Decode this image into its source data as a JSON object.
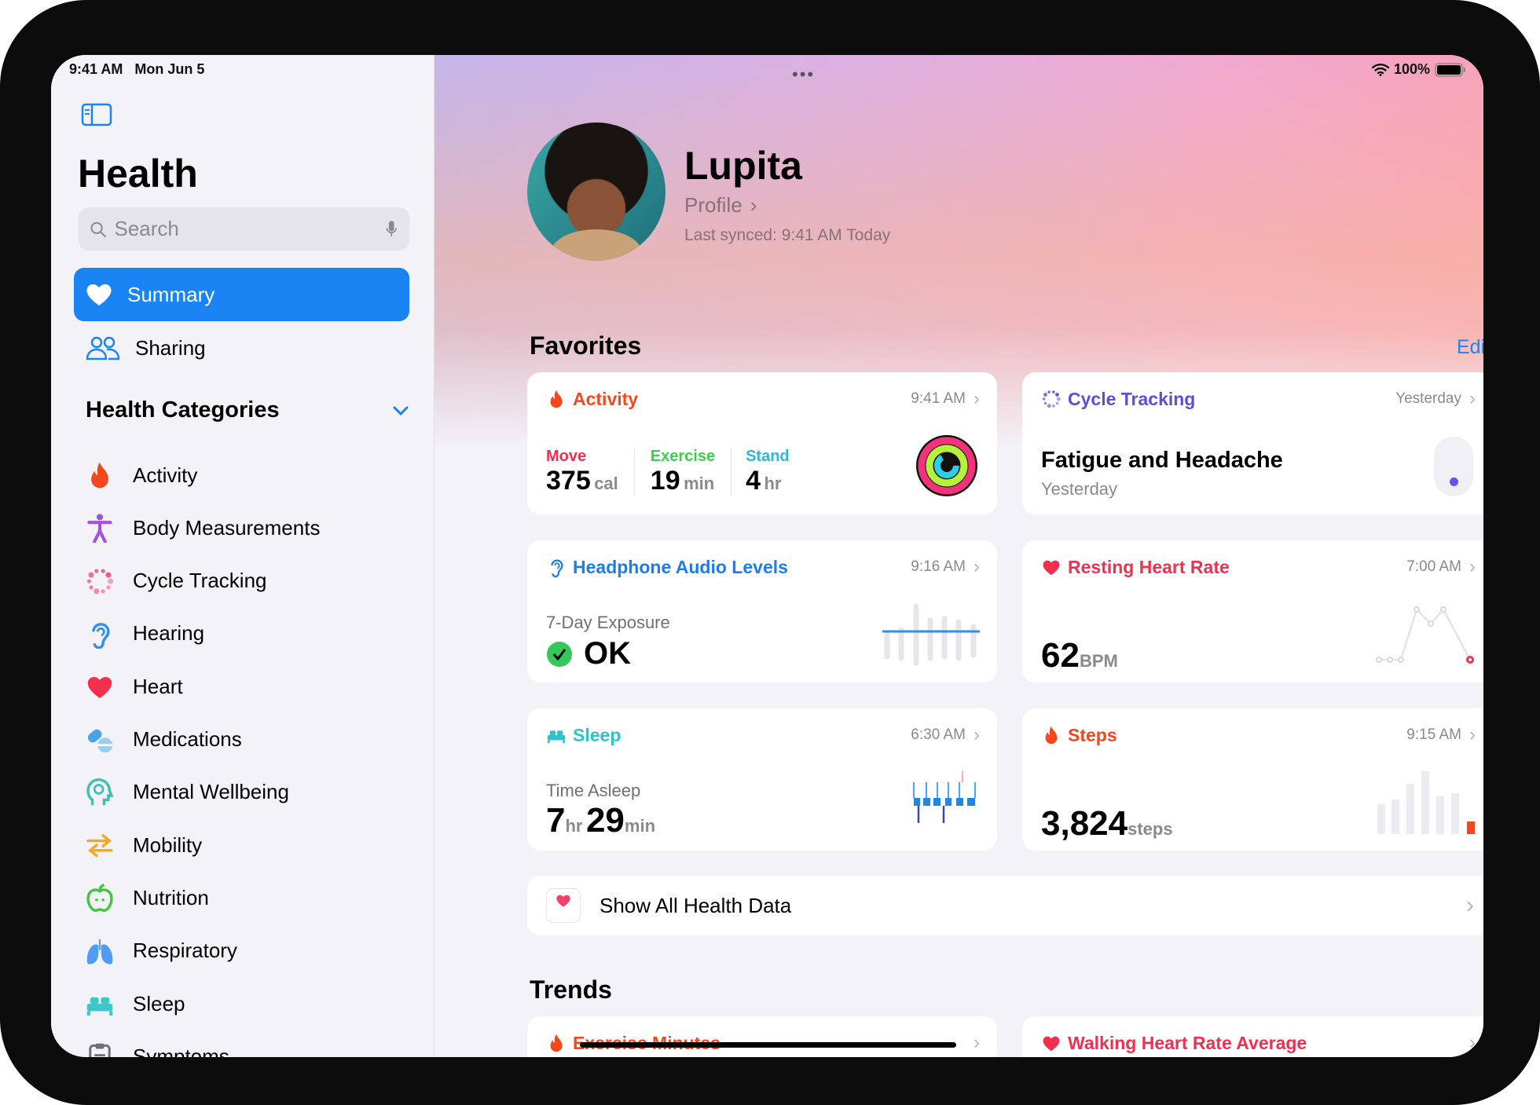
{
  "status": {
    "time": "9:41 AM",
    "date": "Mon Jun 5",
    "battery": "100%"
  },
  "sidebar": {
    "title": "Health",
    "search_placeholder": "Search",
    "nav": [
      {
        "label": "Summary",
        "icon": "heart-icon"
      },
      {
        "label": "Sharing",
        "icon": "people-icon"
      }
    ],
    "categories_title": "Health Categories",
    "categories": [
      {
        "label": "Activity",
        "icon": "flame-icon",
        "color": "#f5471d"
      },
      {
        "label": "Body Measurements",
        "icon": "figure-icon",
        "color": "#a650e0"
      },
      {
        "label": "Cycle Tracking",
        "icon": "cycle-icon",
        "color": "#f0527a"
      },
      {
        "label": "Hearing",
        "icon": "ear-icon",
        "color": "#2f8ef5"
      },
      {
        "label": "Heart",
        "icon": "heart-icon",
        "color": "#f5304f"
      },
      {
        "label": "Medications",
        "icon": "pills-icon",
        "color": "#4aa3e8"
      },
      {
        "label": "Mental Wellbeing",
        "icon": "brain-head-icon",
        "color": "#3fbfb0"
      },
      {
        "label": "Mobility",
        "icon": "arrows-icon",
        "color": "#f5a623"
      },
      {
        "label": "Nutrition",
        "icon": "apple-icon",
        "color": "#45c442"
      },
      {
        "label": "Respiratory",
        "icon": "lungs-icon",
        "color": "#4f9cf0"
      },
      {
        "label": "Sleep",
        "icon": "bed-icon",
        "color": "#3ec7c9"
      },
      {
        "label": "Symptoms",
        "icon": "clipboard-icon",
        "color": "#6e6e73"
      }
    ]
  },
  "profile": {
    "name": "Lupita",
    "link": "Profile",
    "synced": "Last synced: 9:41 AM Today"
  },
  "favorites": {
    "title": "Favorites",
    "edit": "Edit",
    "activity": {
      "title": "Activity",
      "time": "9:41 AM",
      "move_label": "Move",
      "move": "375",
      "move_unit": "cal",
      "exercise_label": "Exercise",
      "exercise": "19",
      "exercise_unit": "min",
      "stand_label": "Stand",
      "stand": "4",
      "stand_unit": "hr"
    },
    "cycle": {
      "title": "Cycle Tracking",
      "time": "Yesterday",
      "value": "Fatigue and Headache",
      "sub": "Yesterday"
    },
    "audio": {
      "title": "Headphone Audio Levels",
      "time": "9:16 AM",
      "label": "7-Day Exposure",
      "value": "OK"
    },
    "rhr": {
      "title": "Resting Heart Rate",
      "time": "7:00 AM",
      "value": "62",
      "unit": "BPM"
    },
    "sleep": {
      "title": "Sleep",
      "time": "6:30 AM",
      "label": "Time Asleep",
      "hr": "7",
      "hr_unit": "hr",
      "min": "29",
      "min_unit": "min"
    },
    "steps": {
      "title": "Steps",
      "time": "9:15 AM",
      "value": "3,824",
      "unit": "steps"
    },
    "show_all": "Show All Health Data"
  },
  "trends": {
    "title": "Trends",
    "items": [
      {
        "title": "Exercise Minutes"
      },
      {
        "title": "Walking Heart Rate Average"
      }
    ]
  },
  "colors": {
    "accent": "#1a84f5",
    "activity": "#f5471d",
    "cycle": "#5a4fd6",
    "audio": "#1a7ef0",
    "heart": "#f0304f",
    "sleep": "#2fc4c9"
  }
}
